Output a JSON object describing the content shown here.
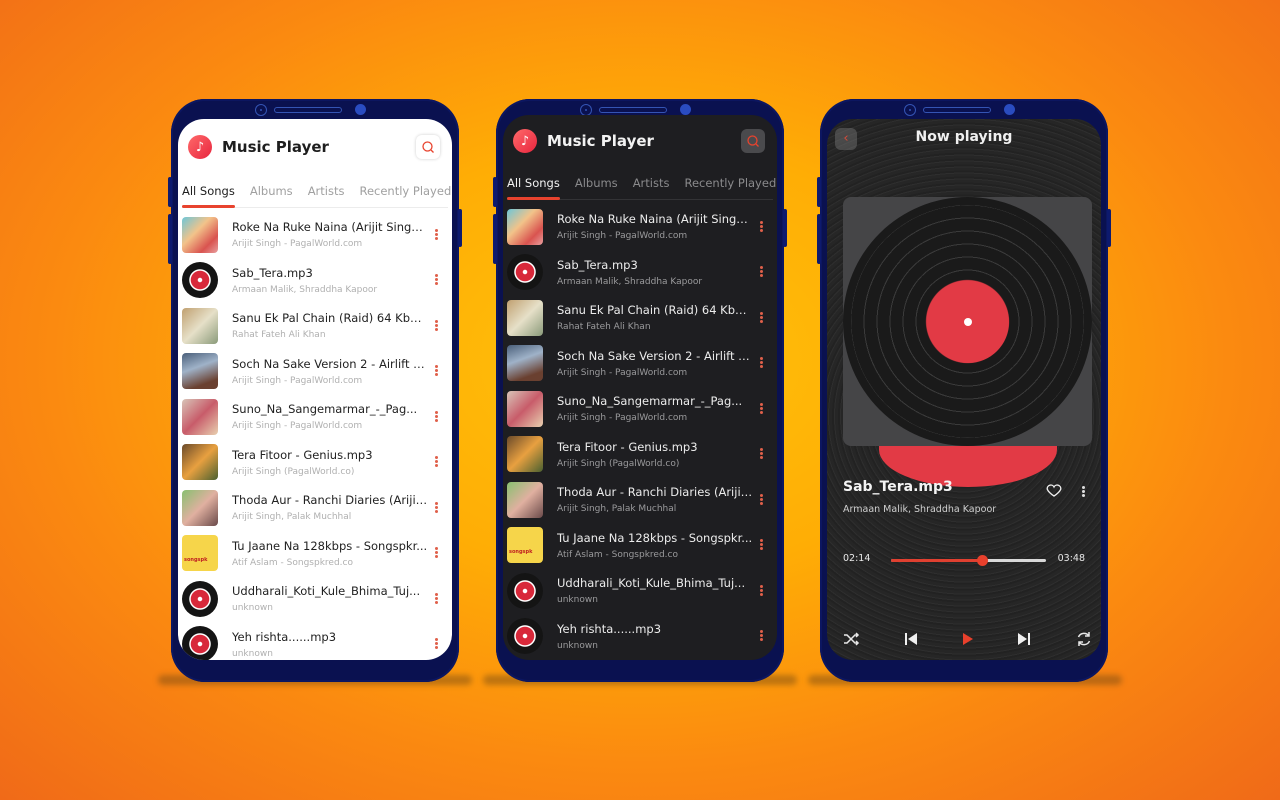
{
  "app": {
    "title": "Music Player",
    "logo_icon": "music-note-icon",
    "search_icon": "search-icon"
  },
  "tabs": [
    "All Songs",
    "Albums",
    "Artists",
    "Recently Played"
  ],
  "active_tab": "All Songs",
  "songs": [
    {
      "title": "Roke Na Ruke Naina (Arijit Singh) ...",
      "artist": "Arijit Singh - PagalWorld.com"
    },
    {
      "title": "Sab_Tera.mp3",
      "artist": "Armaan Malik, Shraddha Kapoor"
    },
    {
      "title": "Sanu Ek Pal Chain (Raid) 64 Kbps....",
      "artist": "Rahat Fateh Ali Khan"
    },
    {
      "title": "Soch Na Sake Version 2 - Airlift (A...",
      "artist": "Arijit Singh - PagalWorld.com"
    },
    {
      "title": "Suno_Na_Sangemarmar_-_Pag...",
      "artist": "Arijit Singh - PagalWorld.com"
    },
    {
      "title": "Tera Fitoor - Genius.mp3",
      "artist": "Arijit Singh (PagalWorld.co)"
    },
    {
      "title": "Thoda Aur - Ranchi Diaries (Arijit ...",
      "artist": "Arijit Singh, Palak Muchhal"
    },
    {
      "title": "Tu Jaane Na 128kbps - Songspkr...",
      "artist": "Atif Aslam - Songspkred.co"
    },
    {
      "title": "Uddharali_Koti_Kule_Bhima_Tuj...",
      "artist": "unknown"
    },
    {
      "title": "Yeh rishta......mp3",
      "artist": "unknown"
    }
  ],
  "now_playing": {
    "header": "Now playing",
    "song": "Sab_Tera.mp3",
    "artist": "Armaan Malik, Shraddha Kapoor",
    "current_time": "02:14",
    "total_time": "03:48",
    "progress_fraction": 0.587,
    "controls": [
      "shuffle-icon",
      "previous-icon",
      "play-icon",
      "next-icon",
      "repeat-icon"
    ]
  },
  "colors": {
    "accent": "#e8432e",
    "record_label": "#e23a45",
    "phone_frame": "#0a1150"
  }
}
